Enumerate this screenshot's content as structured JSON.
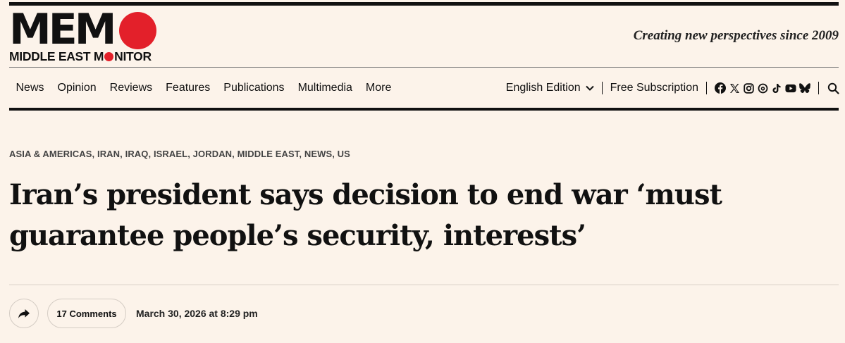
{
  "logo": {
    "main": "MEM",
    "sub_before": "MIDDLE EAST M",
    "sub_after": "NITOR"
  },
  "tagline": "Creating new perspectives since 2009",
  "nav": {
    "items": [
      "News",
      "Opinion",
      "Reviews",
      "Features",
      "Publications",
      "Multimedia",
      "More"
    ],
    "edition": "English Edition",
    "subscribe": "Free Subscription",
    "socials": [
      "facebook-icon",
      "x-icon",
      "instagram-icon",
      "threads-icon",
      "tiktok-icon",
      "youtube-icon",
      "bluesky-icon"
    ]
  },
  "article": {
    "categories": [
      "ASIA & AMERICAS",
      "IRAN",
      "IRAQ",
      "ISRAEL",
      "JORDAN",
      "MIDDLE EAST",
      "NEWS",
      "US"
    ],
    "headline_line1": "Iran’s president says decision to end war ‘must",
    "headline_line2": "guarantee people’s security, interests’",
    "comments": "17 Comments",
    "date": "March 30, 2026 at 8:29 pm"
  },
  "colors": {
    "background": "#fcf3ea",
    "brand_red": "#e3202a",
    "text": "#111111"
  }
}
